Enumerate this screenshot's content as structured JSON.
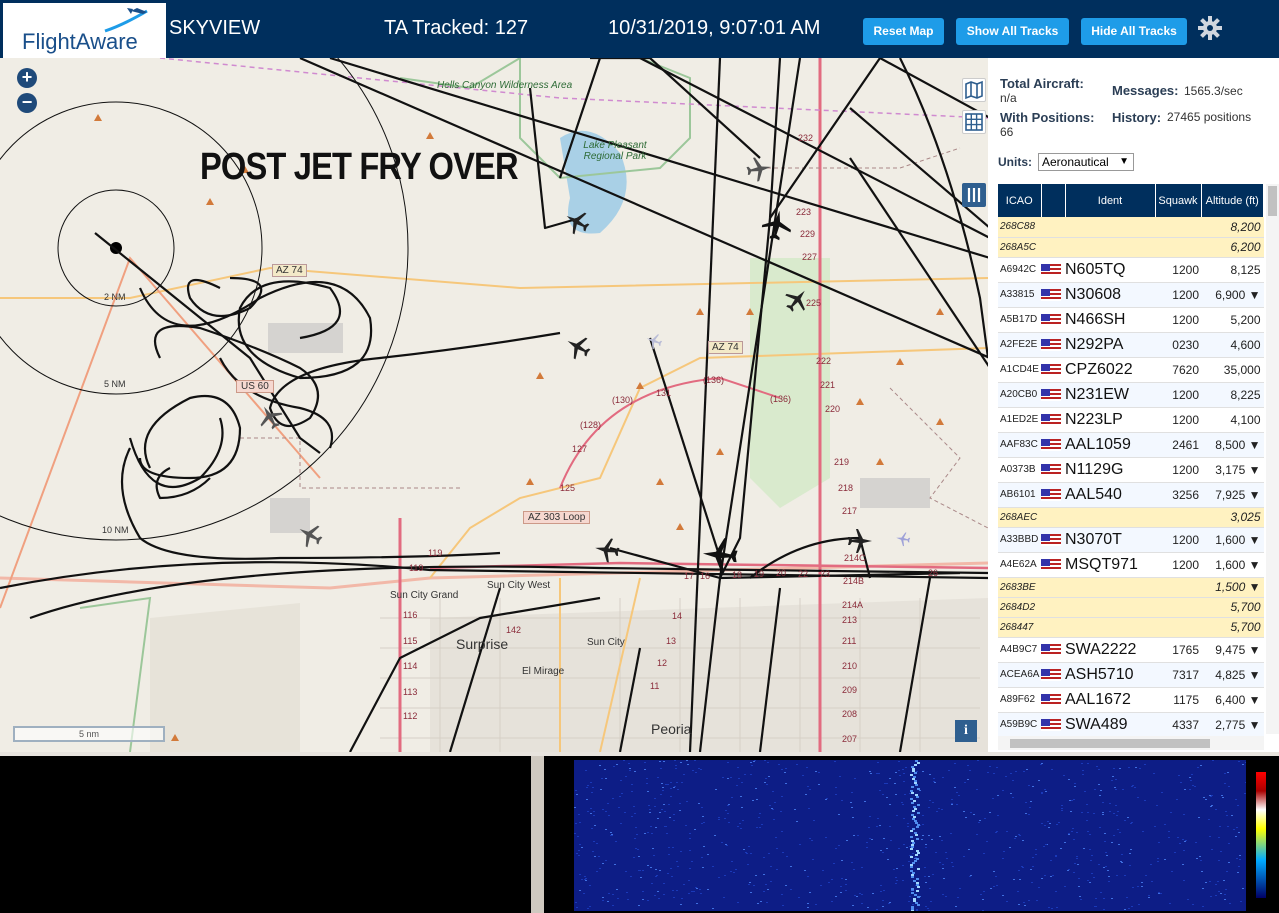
{
  "header": {
    "logo_text": "FlightAware",
    "site_name": "SKYVIEW",
    "tracked": "TA Tracked: 127",
    "clock": "10/31/2019, 9:07:01 AM",
    "buttons": {
      "reset": "Reset Map",
      "show": "Show All Tracks",
      "hide": "Hide All Tracks"
    }
  },
  "map": {
    "zoom_in": "+",
    "zoom_out": "−",
    "caption": "POST JET FRY OVER",
    "scale": "5 nm",
    "info": "i",
    "rings": [
      "2 NM",
      "5 NM",
      "10 NM"
    ],
    "places": {
      "hells_canyon": "Hells Canyon Wilderness Area",
      "lake_pleasant": "Lake Pleasant Regional Park",
      "sun_city_grand": "Sun City Grand",
      "sun_city_west": "Sun City West",
      "surprise": "Surprise",
      "sun_city": "Sun City",
      "el_mirage": "El Mirage",
      "peoria": "Peoria"
    },
    "highways": {
      "az74_a": "AZ 74",
      "az74_b": "AZ 74",
      "us60": "US 60",
      "az303": "AZ 303 Loop"
    },
    "route_numbers": [
      "232",
      "223",
      "229",
      "227",
      "225",
      "222",
      "221",
      "220",
      "219",
      "218",
      "217",
      "214C",
      "214B",
      "214A",
      "213",
      "211",
      "210",
      "209",
      "208",
      "207",
      "131",
      "(130)",
      "(136)",
      "(136)",
      "(128)",
      "127",
      "125",
      "119",
      "119",
      "116",
      "115",
      "114",
      "113",
      "112",
      "142",
      "14",
      "13",
      "12",
      "11",
      "17",
      "16",
      "18",
      "19",
      "20",
      "22",
      "23",
      "26"
    ]
  },
  "sidebar": {
    "total_aircraft_label": "Total Aircraft:",
    "total_aircraft_value": "n/a",
    "messages_label": "Messages:",
    "messages_value": "1565.3/sec",
    "with_positions_label": "With Positions:",
    "with_positions_value": "66",
    "history_label": "History:",
    "history_value": "27465 positions",
    "units_label": "Units:",
    "units_value": "Aeronautical",
    "columns": [
      "ICAO",
      "",
      "Ident",
      "Squawk",
      "Altitude (ft)"
    ],
    "rows": [
      {
        "icao": "268C88",
        "ident": "",
        "squawk": "",
        "alt": "8,200",
        "mlat": true,
        "flag": false
      },
      {
        "icao": "268A5C",
        "ident": "",
        "squawk": "",
        "alt": "6,200",
        "mlat": true,
        "flag": false
      },
      {
        "icao": "A6942C",
        "ident": "N605TQ",
        "squawk": "1200",
        "alt": "8,125",
        "mlat": false,
        "flag": true
      },
      {
        "icao": "A33815",
        "ident": "N30608",
        "squawk": "1200",
        "alt": "6,900 ▼",
        "mlat": false,
        "flag": true
      },
      {
        "icao": "A5B17D",
        "ident": "N466SH",
        "squawk": "1200",
        "alt": "5,200",
        "mlat": false,
        "flag": true
      },
      {
        "icao": "A2FE2E",
        "ident": "N292PA",
        "squawk": "0230",
        "alt": "4,600",
        "mlat": false,
        "flag": true
      },
      {
        "icao": "A1CD4E",
        "ident": "CPZ6022",
        "squawk": "7620",
        "alt": "35,000",
        "mlat": false,
        "flag": true
      },
      {
        "icao": "A20CB0",
        "ident": "N231EW",
        "squawk": "1200",
        "alt": "8,225",
        "mlat": false,
        "flag": true
      },
      {
        "icao": "A1ED2E",
        "ident": "N223LP",
        "squawk": "1200",
        "alt": "4,100",
        "mlat": false,
        "flag": true
      },
      {
        "icao": "AAF83C",
        "ident": "AAL1059",
        "squawk": "2461",
        "alt": "8,500 ▼",
        "mlat": false,
        "flag": true
      },
      {
        "icao": "A0373B",
        "ident": "N1129G",
        "squawk": "1200",
        "alt": "3,175 ▼",
        "mlat": false,
        "flag": true
      },
      {
        "icao": "AB6101",
        "ident": "AAL540",
        "squawk": "3256",
        "alt": "7,925 ▼",
        "mlat": false,
        "flag": true
      },
      {
        "icao": "268AEC",
        "ident": "",
        "squawk": "",
        "alt": "3,025",
        "mlat": true,
        "flag": false
      },
      {
        "icao": "A33BBD",
        "ident": "N3070T",
        "squawk": "1200",
        "alt": "1,600 ▼",
        "mlat": false,
        "flag": true
      },
      {
        "icao": "A4E62A",
        "ident": "MSQT971",
        "squawk": "1200",
        "alt": "1,600 ▼",
        "mlat": false,
        "flag": true
      },
      {
        "icao": "2683BE",
        "ident": "",
        "squawk": "",
        "alt": "1,500 ▼",
        "mlat": true,
        "flag": false
      },
      {
        "icao": "2684D2",
        "ident": "",
        "squawk": "",
        "alt": "5,700",
        "mlat": true,
        "flag": false
      },
      {
        "icao": "268447",
        "ident": "",
        "squawk": "",
        "alt": "5,700",
        "mlat": true,
        "flag": false
      },
      {
        "icao": "A4B9C7",
        "ident": "SWA2222",
        "squawk": "1765",
        "alt": "9,475 ▼",
        "mlat": false,
        "flag": true
      },
      {
        "icao": "ACEA6A",
        "ident": "ASH5710",
        "squawk": "7317",
        "alt": "4,825 ▼",
        "mlat": false,
        "flag": true
      },
      {
        "icao": "A89F62",
        "ident": "AAL1672",
        "squawk": "1175",
        "alt": "6,400 ▼",
        "mlat": false,
        "flag": true
      },
      {
        "icao": "A59B9C",
        "ident": "SWA489",
        "squawk": "4337",
        "alt": "2,775 ▼",
        "mlat": false,
        "flag": true
      }
    ]
  },
  "colors": {
    "header_bg": "#002f5d",
    "button": "#1e9ce8",
    "mlat_row": "#fff2c1",
    "waterfall": "#0d1d86"
  },
  "icons": {
    "gear": "gear-icon",
    "layers": "map-layers-icon",
    "grid": "grid-icon",
    "columns": "columns-icon",
    "plane": "airplane-icon"
  }
}
